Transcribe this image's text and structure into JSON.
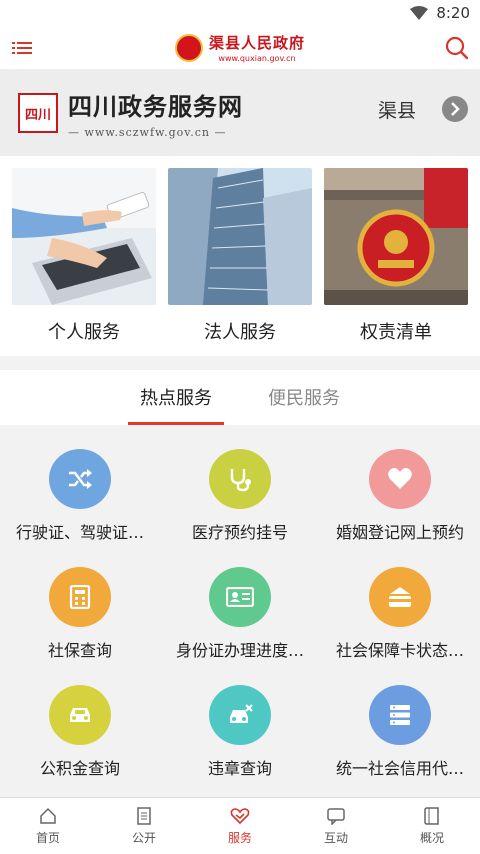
{
  "status": {
    "time": "8:20"
  },
  "header": {
    "site_title": "渠县人民政府",
    "site_url": "www.quxian.gov.cn"
  },
  "portal": {
    "seal_text": "四川",
    "title": "四川政务服务网",
    "url": "— www.sczwfw.gov.cn —",
    "region": "渠县"
  },
  "cards": [
    {
      "label": "个人服务"
    },
    {
      "label": "法人服务"
    },
    {
      "label": "权责清单"
    }
  ],
  "tabs": [
    {
      "label": "热点服务"
    },
    {
      "label": "便民服务"
    }
  ],
  "services": [
    {
      "label": "行驶证、驾驶证…",
      "color": "#6fa6e0",
      "icon": "shuffle-icon"
    },
    {
      "label": "医疗预约挂号",
      "color": "#c9d042",
      "icon": "stethoscope-icon"
    },
    {
      "label": "婚姻登记网上预约",
      "color": "#f29a9a",
      "icon": "heart-icon"
    },
    {
      "label": "社保查询",
      "color": "#f0a93a",
      "icon": "calculator-icon"
    },
    {
      "label": "身份证办理进度…",
      "color": "#5fc98e",
      "icon": "id-card-icon"
    },
    {
      "label": "社会保障卡状态…",
      "color": "#f0a93a",
      "icon": "bank-card-icon"
    },
    {
      "label": "公积金查询",
      "color": "#d6d23e",
      "icon": "car-icon"
    },
    {
      "label": "违章查询",
      "color": "#4fc8c4",
      "icon": "violation-car-icon"
    },
    {
      "label": "统一社会信用代…",
      "color": "#6b9de0",
      "icon": "server-icon"
    }
  ],
  "tabbar": [
    {
      "label": "首页",
      "icon": "home-icon"
    },
    {
      "label": "公开",
      "icon": "document-icon"
    },
    {
      "label": "服务",
      "icon": "service-icon"
    },
    {
      "label": "互动",
      "icon": "chat-icon"
    },
    {
      "label": "概况",
      "icon": "book-icon"
    }
  ],
  "colors": {
    "accent": "#d9362b",
    "header_red": "#c8161d"
  }
}
